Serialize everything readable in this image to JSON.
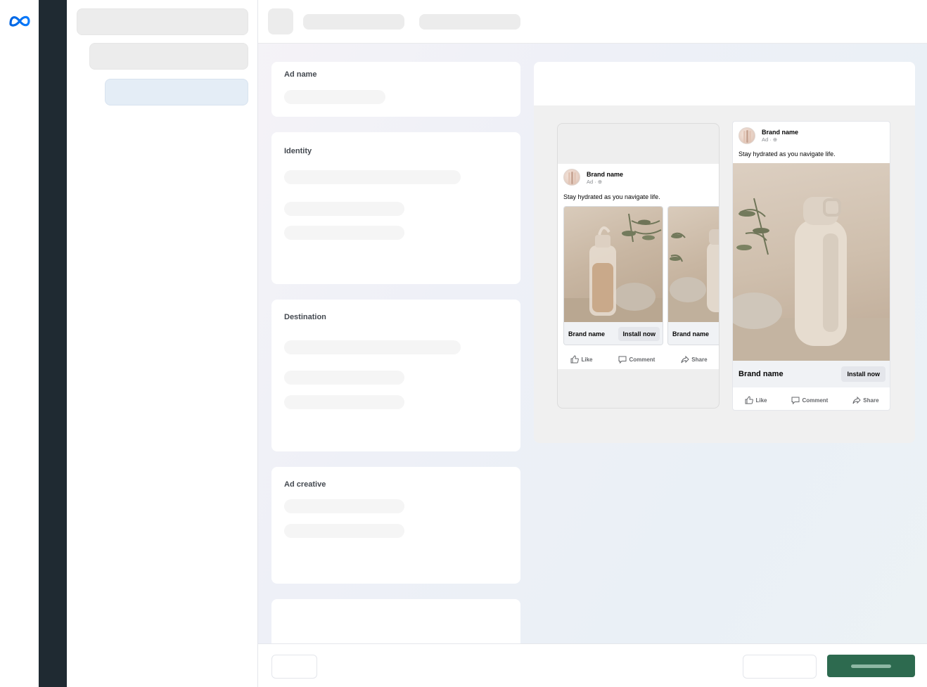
{
  "sections": {
    "ad_name": "Ad name",
    "identity": "Identity",
    "destination": "Destination",
    "ad_creative": "Ad creative"
  },
  "carousel_preview": {
    "brand_name": "Brand name",
    "ad_label": "Ad · ",
    "caption": "Stay hydrated as you navigate life.",
    "cards": [
      {
        "brand": "Brand name",
        "cta": "Install now"
      },
      {
        "brand": "Brand name",
        "cta": ""
      }
    ],
    "actions": {
      "like": "Like",
      "comment": "Comment",
      "share": "Share"
    }
  },
  "feed_preview": {
    "brand_name": "Brand name",
    "ad_label": "Ad · ",
    "caption": "Stay hydrated as you navigate life.",
    "headline_brand": "Brand name",
    "cta": "Install now",
    "actions": {
      "like": "Like",
      "comment": "Comment",
      "share": "Share"
    }
  },
  "icons": [
    "meta-logo-icon",
    "like-icon",
    "comment-icon",
    "share-icon",
    "globe-icon"
  ],
  "colors": {
    "dark_rail": "#1f2a32",
    "primary_button": "#2d6a4f",
    "meta_blue": "#0668e1",
    "selected_nav": "#e4edf6"
  }
}
